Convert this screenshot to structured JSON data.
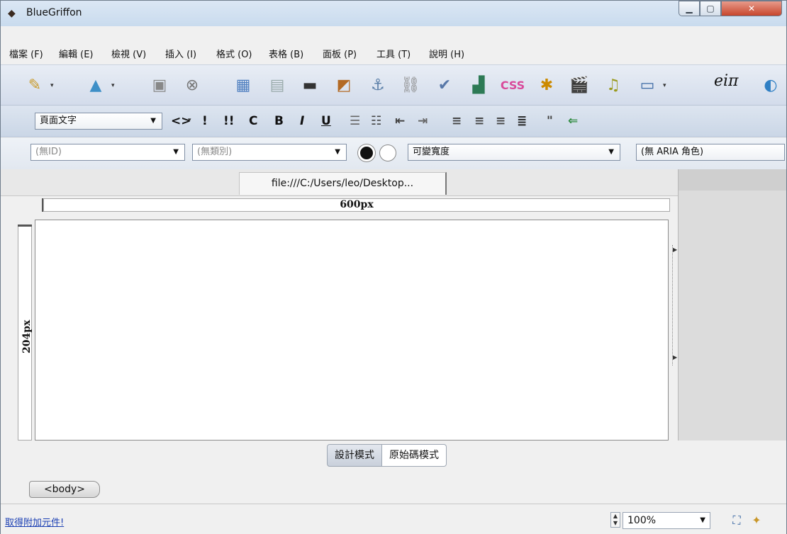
{
  "window": {
    "title": "BlueGriffon"
  },
  "menu": {
    "items": [
      {
        "label": "檔案 (F)"
      },
      {
        "label": "編輯 (E)"
      },
      {
        "label": "檢視 (V)"
      },
      {
        "label": "插入 (I)"
      },
      {
        "label": "格式 (O)"
      },
      {
        "label": "表格 (B)"
      },
      {
        "label": "面板 (P)"
      },
      {
        "label": "工具 (T)"
      },
      {
        "label": "說明 (H)"
      }
    ]
  },
  "toolbar": {
    "icons": [
      "new-document-icon",
      "publish-icon",
      "save-icon",
      "close-document-icon",
      "table-icon",
      "form-icon",
      "image-icon",
      "image-map-icon",
      "anchor-icon",
      "link-icon",
      "spell-check-icon",
      "chart-icon",
      "css-icon",
      "style-icon",
      "video-icon",
      "audio-icon",
      "window-icon",
      "math-icon",
      "browser-icon"
    ],
    "math_label": "eiπ"
  },
  "format_bar": {
    "paragraph_format": "頁面文字",
    "buttons": [
      {
        "label": "<>"
      },
      {
        "label": "!"
      },
      {
        "label": "!!"
      },
      {
        "label": "C"
      },
      {
        "label": "B"
      },
      {
        "label": "I"
      },
      {
        "label": "U"
      },
      {
        "label": "☰"
      },
      {
        "label": "☷"
      },
      {
        "label": "⇤"
      },
      {
        "label": "⇥"
      },
      {
        "label": "≡"
      },
      {
        "label": "≡"
      },
      {
        "label": "≡"
      },
      {
        "label": "≣"
      },
      {
        "label": "\""
      },
      {
        "label": "⇐"
      }
    ]
  },
  "style_bar": {
    "id_select": "(無ID)",
    "class_select": "(無類別)",
    "width_select": "可變寬度",
    "aria_select": "(無 ARIA 角色)"
  },
  "tabs": [
    {
      "label": "file:///C:/Users/leo/Desktop..."
    }
  ],
  "rulers": {
    "width_label": "600px",
    "height_label": "204px"
  },
  "mode": {
    "design": "設計模式",
    "source": "原始碼模式"
  },
  "breadcrumb": {
    "element": "<body>"
  },
  "status": {
    "addons_link": "取得附加元件!",
    "zoom": "100%"
  }
}
